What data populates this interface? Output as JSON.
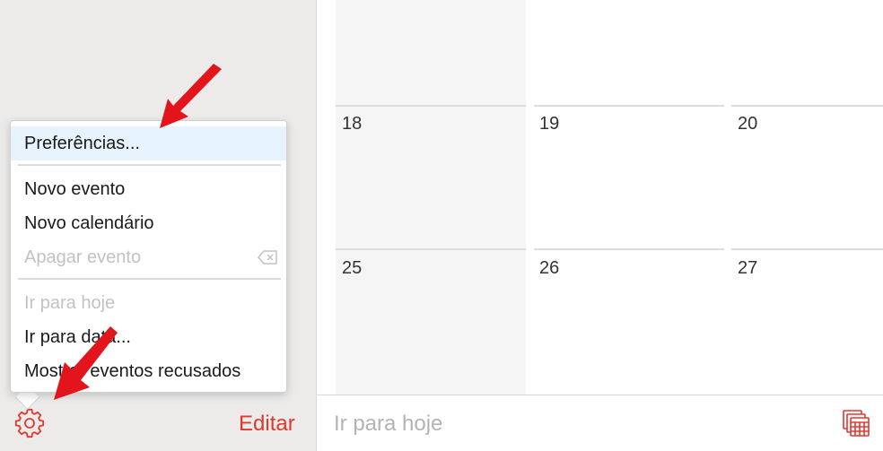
{
  "calendar": {
    "rows": [
      [
        "18",
        "19",
        "20"
      ],
      [
        "25",
        "26",
        "27"
      ]
    ]
  },
  "menu": {
    "items": [
      {
        "label": "Preferências...",
        "state": "highlighted"
      },
      {
        "label": "Novo evento",
        "state": "enabled"
      },
      {
        "label": "Novo calendário",
        "state": "enabled"
      },
      {
        "label": "Apagar evento",
        "state": "disabled",
        "icon": "delete-backward-icon"
      },
      {
        "label": "Ir para hoje",
        "state": "disabled"
      },
      {
        "label": "Ir para data...",
        "state": "enabled"
      },
      {
        "label": "Mostrar eventos recusados",
        "state": "enabled"
      }
    ]
  },
  "toolbar": {
    "edit_label": "Editar",
    "today_label": "Ir para hoje",
    "gear_icon": "gear-icon",
    "calendar_icon": "calendars-icon"
  },
  "colors": {
    "accent": "#e0382e",
    "annotation": "#e3141b",
    "highlight": "#e6f2fc"
  }
}
